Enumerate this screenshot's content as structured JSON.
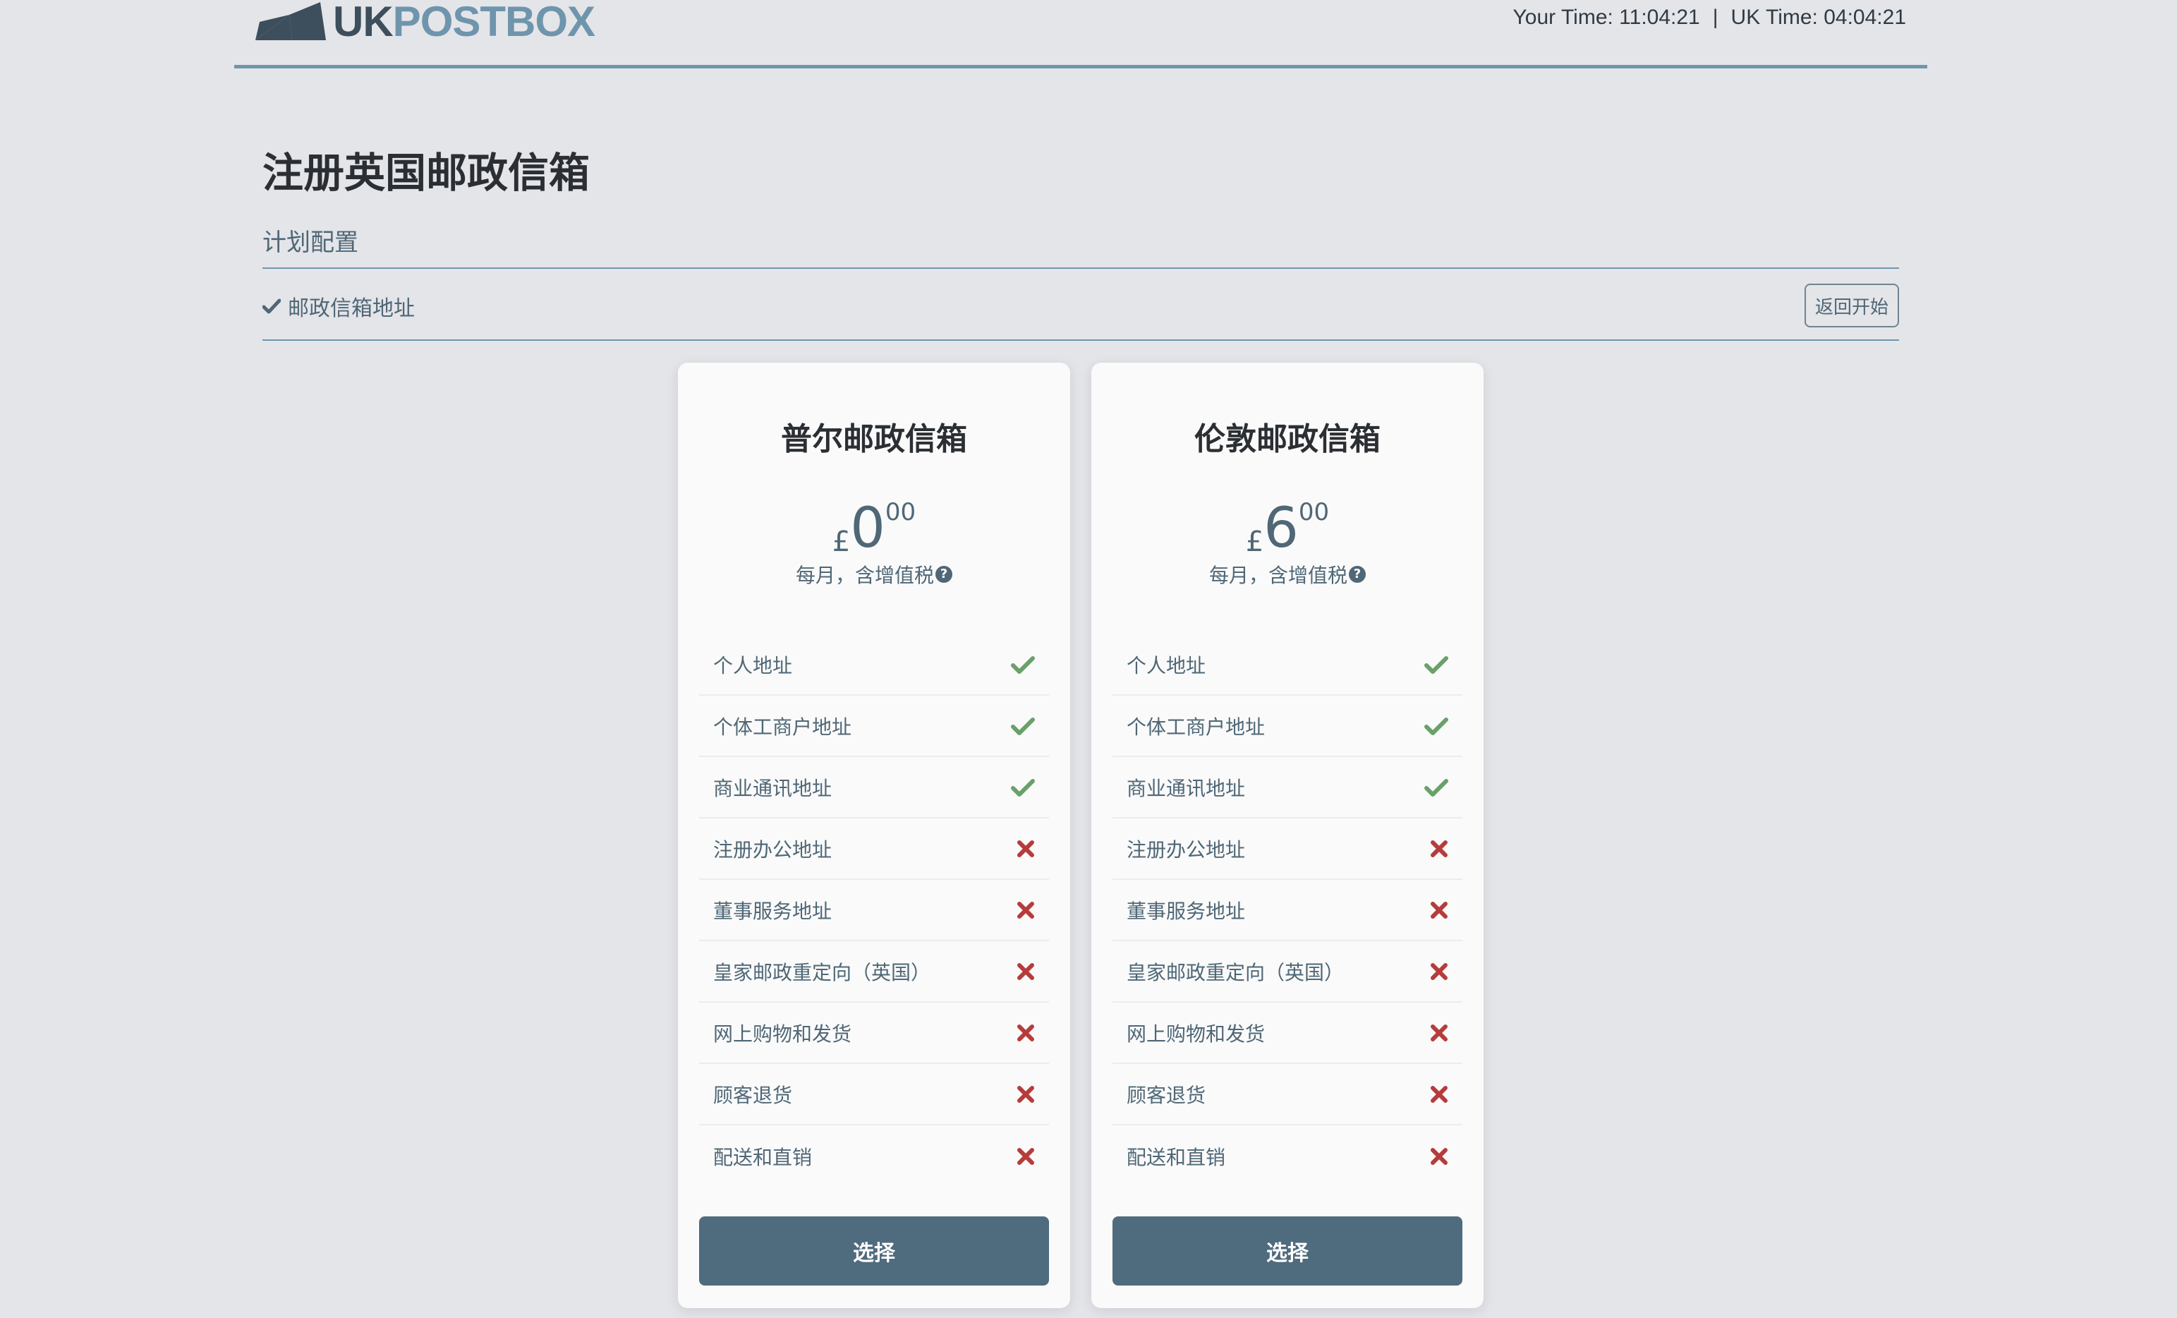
{
  "header": {
    "logo_uk": "UK",
    "logo_post": "POSTBOX",
    "your_time": "Your Time: 11:04:21",
    "separator": "|",
    "uk_time": "UK Time: 04:04:21"
  },
  "page": {
    "title": "注册英国邮政信箱",
    "section_label": "计划配置",
    "completed_step": "邮政信箱地址",
    "restart_button": "返回开始"
  },
  "plans": [
    {
      "name": "普尔邮政信箱",
      "currency": "£",
      "price_whole": "0",
      "price_cents": "00",
      "price_note": "每月，含增值税",
      "select_label": "选择",
      "features": [
        {
          "label": "个人地址",
          "included": true
        },
        {
          "label": "个体工商户地址",
          "included": true
        },
        {
          "label": "商业通讯地址",
          "included": true
        },
        {
          "label": "注册办公地址",
          "included": false
        },
        {
          "label": "董事服务地址",
          "included": false
        },
        {
          "label": "皇家邮政重定向（英国）",
          "included": false
        },
        {
          "label": "网上购物和发货",
          "included": false
        },
        {
          "label": "顾客退货",
          "included": false
        },
        {
          "label": "配送和直销",
          "included": false
        }
      ]
    },
    {
      "name": "伦敦邮政信箱",
      "currency": "£",
      "price_whole": "6",
      "price_cents": "00",
      "price_note": "每月，含增值税",
      "select_label": "选择",
      "features": [
        {
          "label": "个人地址",
          "included": true
        },
        {
          "label": "个体工商户地址",
          "included": true
        },
        {
          "label": "商业通讯地址",
          "included": true
        },
        {
          "label": "注册办公地址",
          "included": false
        },
        {
          "label": "董事服务地址",
          "included": false
        },
        {
          "label": "皇家邮政重定向（英国）",
          "included": false
        },
        {
          "label": "网上购物和发货",
          "included": false
        },
        {
          "label": "顾客退货",
          "included": false
        },
        {
          "label": "配送和直销",
          "included": false
        }
      ]
    }
  ],
  "icons": {
    "included": "check-icon",
    "excluded": "cross-icon",
    "help": "question-circle-icon"
  },
  "colors": {
    "accent": "#6f95ad",
    "button": "#4f6b7e",
    "check": "#6aa06a",
    "cross": "#b63c3c"
  }
}
